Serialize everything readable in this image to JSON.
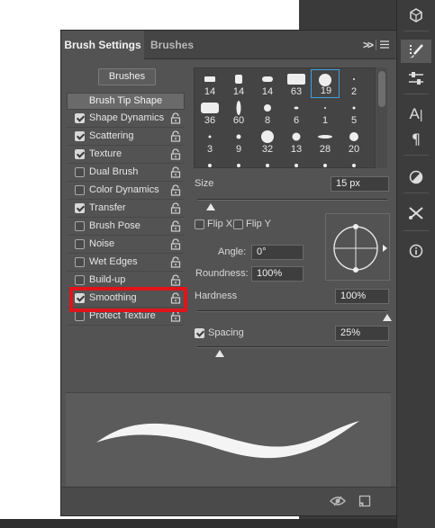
{
  "panel": {
    "tabs": [
      {
        "label": "Brush Settings",
        "active": true
      },
      {
        "label": "Brushes",
        "active": false
      }
    ],
    "brushes_button": "Brushes",
    "brush_tip_shape": "Brush Tip Shape",
    "options": [
      {
        "label": "Shape Dynamics",
        "checked": true
      },
      {
        "label": "Scattering",
        "checked": true
      },
      {
        "label": "Texture",
        "checked": true
      },
      {
        "label": "Dual Brush",
        "checked": false
      },
      {
        "label": "Color Dynamics",
        "checked": false
      },
      {
        "label": "Transfer",
        "checked": true
      },
      {
        "label": "Brush Pose",
        "checked": false
      },
      {
        "label": "Noise",
        "checked": false
      },
      {
        "label": "Wet Edges",
        "checked": false
      },
      {
        "label": "Build-up",
        "checked": false
      },
      {
        "label": "Smoothing",
        "checked": true
      },
      {
        "label": "Protect Texture",
        "checked": false
      }
    ],
    "tip_sizes": [
      "14",
      "14",
      "14",
      "63",
      "19",
      "2",
      "36",
      "60",
      "8",
      "6",
      "1",
      "5",
      "3",
      "9",
      "32",
      "13",
      "28",
      "20"
    ],
    "selected_tip": "19",
    "size_label": "Size",
    "size_value": "15 px",
    "size_slider_fraction": 0.07,
    "flip_x_label": "Flip X",
    "flip_y_label": "Flip Y",
    "angle_label": "Angle:",
    "angle_value": "0°",
    "roundness_label": "Roundness:",
    "roundness_value": "100%",
    "hardness_label": "Hardness",
    "hardness_value": "100%",
    "hardness_slider_fraction": 1.0,
    "spacing_label": "Spacing",
    "spacing_checked": true,
    "spacing_value": "25%",
    "spacing_slider_fraction": 0.12
  },
  "toolbar": {
    "icons": [
      "3d-icon",
      "brush-settings-icon",
      "adjustments-icon",
      "character-icon",
      "paragraph-icon",
      "color-wheel-icon",
      "tools-icon",
      "info-icon"
    ],
    "active": "brush-settings-icon"
  },
  "colors": {
    "highlight": "#e0141a",
    "selection": "#40a0e0",
    "panel_bg": "#535353"
  }
}
